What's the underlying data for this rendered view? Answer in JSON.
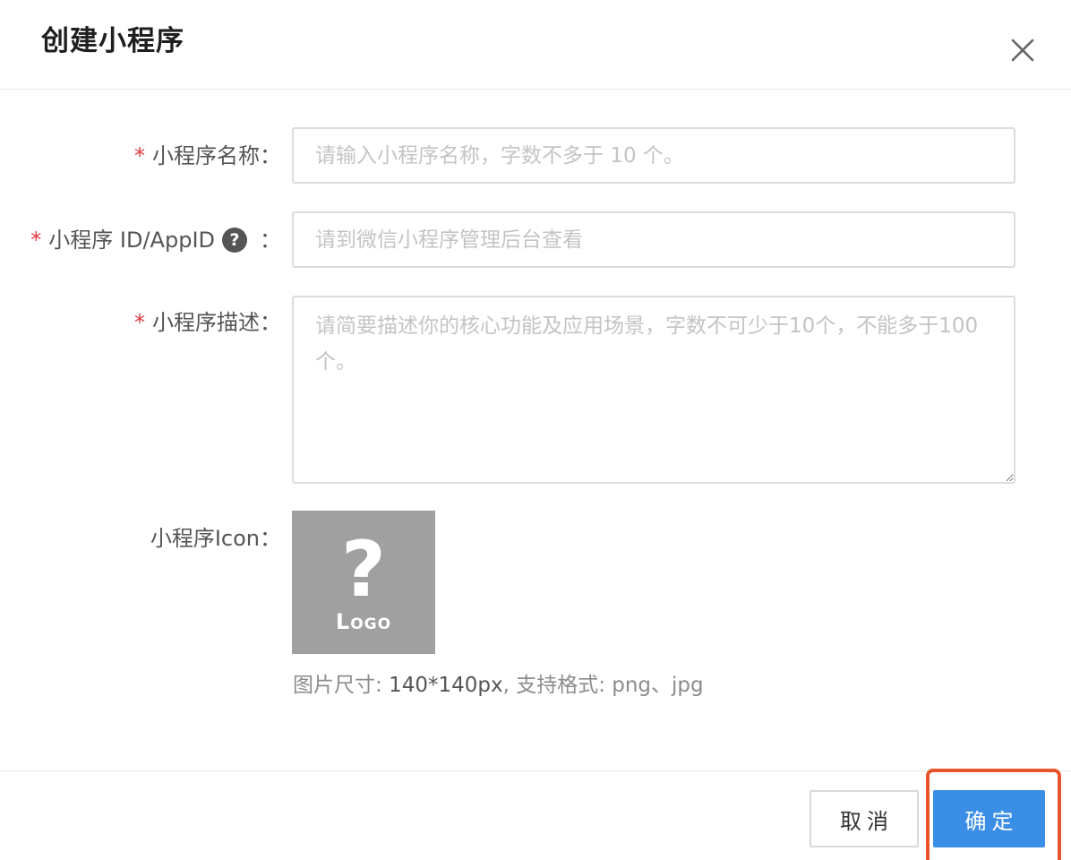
{
  "dialog": {
    "title": "创建小程序"
  },
  "form": {
    "name": {
      "required_mark": "*",
      "label": "小程序名称：",
      "placeholder": "请输入小程序名称，字数不多于 10 个。",
      "value": ""
    },
    "appid": {
      "required_mark": "*",
      "label": "小程序 ID/AppID",
      "help": "?",
      "colon": "：",
      "placeholder": "请到微信小程序管理后台查看",
      "value": ""
    },
    "description": {
      "required_mark": "*",
      "label": "小程序描述：",
      "placeholder": "请简要描述你的核心功能及应用场景，字数不可少于10个，不能多于100个。",
      "value": ""
    },
    "icon": {
      "label": "小程序Icon：",
      "placeholder_glyph": "?",
      "placeholder_text": "Logo",
      "hint_prefix": "图片尺寸: ",
      "hint_size": "140*140px",
      "hint_suffix": ", 支持格式: png、jpg"
    }
  },
  "footer": {
    "cancel_label": "取消",
    "confirm_label": "确定"
  },
  "colors": {
    "primary": "#3a8ee6",
    "required": "#e0393e",
    "highlight": "#e8552a",
    "placeholder_bg": "#a0a0a0"
  }
}
